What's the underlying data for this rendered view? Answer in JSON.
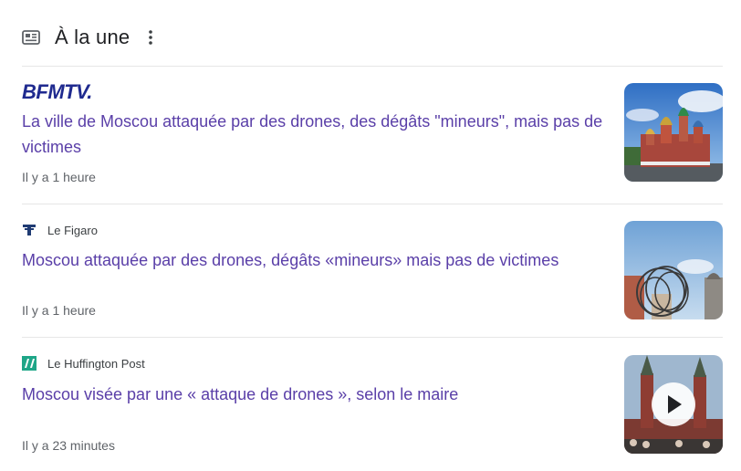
{
  "section": {
    "title": "À la une",
    "icon": "newspaper-icon",
    "menu_icon": "more-vert-icon"
  },
  "articles": [
    {
      "source": "BFMTV.",
      "source_style": "logo-text",
      "headline": "La ville de Moscou attaquée par des drones, des dégâts \"mineurs\", mais pas de victimes",
      "time": "Il y a 1 heure",
      "thumbnail": "kremlin-st-basils-photo"
    },
    {
      "source": "Le Figaro",
      "source_icon": "le-figaro-icon",
      "headline": "Moscou attaquée par des drones, dégâts «mineurs» mais pas de victimes",
      "time": "Il y a 1 heure",
      "thumbnail": "barbed-wire-red-square-photo"
    },
    {
      "source": "Le Huffington Post",
      "source_icon": "huffpost-icon",
      "headline": "Moscou visée par une « attaque de drones », selon le maire",
      "time": "Il y a 23 minutes",
      "thumbnail": "red-square-video-thumbnail",
      "has_video": true
    }
  ],
  "colors": {
    "headline": "#5a3fa8",
    "bfm_logo": "#1f2a8f",
    "huffpost": "#1ea688",
    "meta_text": "#5f6368",
    "divider": "#e6e6e6"
  }
}
